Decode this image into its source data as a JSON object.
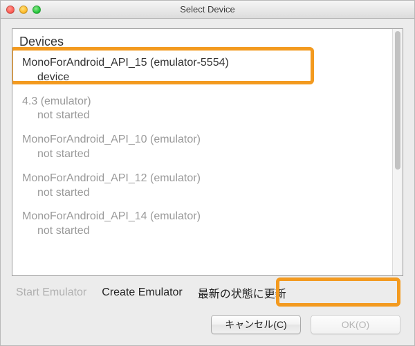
{
  "window": {
    "title": "Select Device"
  },
  "panel": {
    "header": "Devices"
  },
  "devices": [
    {
      "name": "MonoForAndroid_API_15 (emulator-5554)",
      "status": "device",
      "style": "normal"
    },
    {
      "name": "4.3 (emulator)",
      "status": "not started",
      "style": "dim"
    },
    {
      "name": "MonoForAndroid_API_10 (emulator)",
      "status": "not started",
      "style": "dim"
    },
    {
      "name": "MonoForAndroid_API_12 (emulator)",
      "status": "not started",
      "style": "dim"
    },
    {
      "name": "MonoForAndroid_API_14 (emulator)",
      "status": "not started",
      "style": "dim"
    }
  ],
  "actions": {
    "start_emulator": "Start Emulator",
    "create_emulator": "Create Emulator",
    "refresh": "最新の状態に更新"
  },
  "footer": {
    "cancel": "キャンセル(C)",
    "ok": "OK(O)"
  }
}
